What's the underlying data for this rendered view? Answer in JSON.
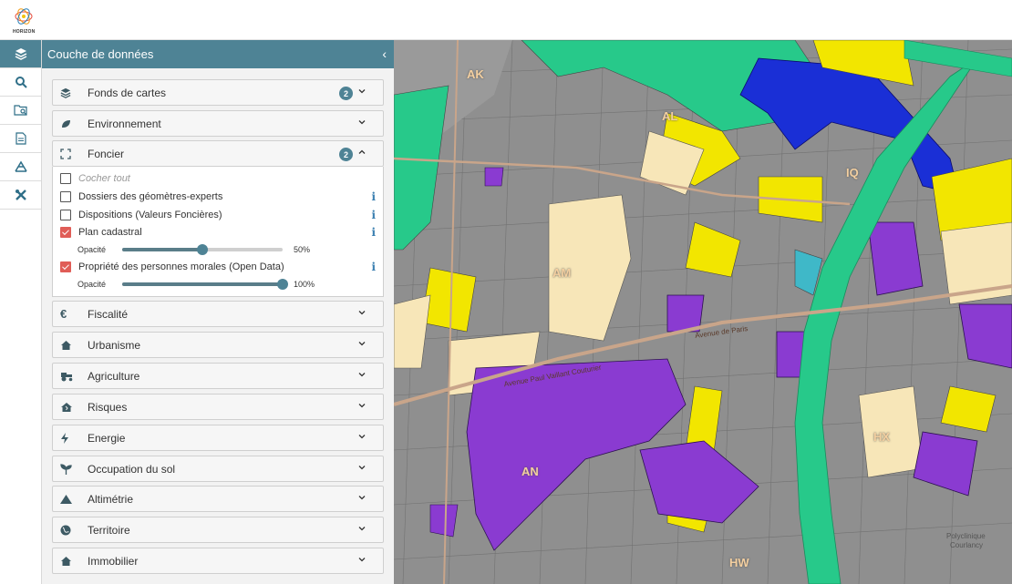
{
  "app": {
    "logo_text": "HORIZON"
  },
  "rail": {
    "items": [
      {
        "icon": "layers-icon",
        "active": true
      },
      {
        "icon": "search-icon",
        "active": false
      },
      {
        "icon": "folder-search-icon",
        "active": false
      },
      {
        "icon": "document-icon",
        "active": false
      },
      {
        "icon": "measure-icon",
        "active": false
      },
      {
        "icon": "tools-icon",
        "active": false
      }
    ]
  },
  "panel": {
    "title": "Couche de données",
    "collapse_glyph": "‹",
    "sections": [
      {
        "key": "fonds",
        "label": "Fonds de cartes",
        "icon": "layers-icon",
        "badge": "2",
        "expanded": false
      },
      {
        "key": "environnement",
        "label": "Environnement",
        "icon": "leaf-icon",
        "badge": "",
        "expanded": false
      },
      {
        "key": "foncier",
        "label": "Foncier",
        "icon": "expand-corners-icon",
        "badge": "2",
        "expanded": true
      },
      {
        "key": "fiscalite",
        "label": "Fiscalité",
        "icon": "euro-icon",
        "badge": "",
        "expanded": false
      },
      {
        "key": "urbanisme",
        "label": "Urbanisme",
        "icon": "home-icon",
        "badge": "",
        "expanded": false
      },
      {
        "key": "agriculture",
        "label": "Agriculture",
        "icon": "tractor-icon",
        "badge": "",
        "expanded": false
      },
      {
        "key": "risques",
        "label": "Risques",
        "icon": "house-damage-icon",
        "badge": "",
        "expanded": false
      },
      {
        "key": "energie",
        "label": "Energie",
        "icon": "bolt-icon",
        "badge": "",
        "expanded": false
      },
      {
        "key": "occupation",
        "label": "Occupation du sol",
        "icon": "seedling-icon",
        "badge": "",
        "expanded": false
      },
      {
        "key": "altimetrie",
        "label": "Altimétrie",
        "icon": "mountain-icon",
        "badge": "",
        "expanded": false
      },
      {
        "key": "territoire",
        "label": "Territoire",
        "icon": "globe-icon",
        "badge": "",
        "expanded": false
      },
      {
        "key": "immobilier",
        "label": "Immobilier",
        "icon": "home-icon",
        "badge": "",
        "expanded": false
      }
    ],
    "foncier": {
      "check_all": "Cocher tout",
      "layers": [
        {
          "label": "Dossiers des géomètres-experts",
          "checked": false,
          "info": "i"
        },
        {
          "label": "Dispositions (Valeurs Foncières)",
          "checked": false,
          "info": "i"
        },
        {
          "label": "Plan cadastral",
          "checked": true,
          "info": "i",
          "opacity_label": "Opacité",
          "opacity": 50,
          "opacity_text": "50%"
        },
        {
          "label": "Propriété des personnes morales (Open Data)",
          "checked": true,
          "info": "i",
          "opacity_label": "Opacité",
          "opacity": 100,
          "opacity_text": "100%"
        }
      ]
    }
  },
  "map": {
    "parcel_labels": [
      "AK",
      "AL",
      "AM",
      "AN",
      "HW",
      "HX",
      "IQ"
    ],
    "street_labels": [
      "Avenue Paul Vaillant Couturier",
      "Avenue de Paris"
    ],
    "poi_labels": [
      "Polyclinique",
      "Courlancy"
    ],
    "colors": {
      "purple": "#8a3bd1",
      "yellow": "#f2e600",
      "green": "#27c98a",
      "blue": "#1a2fd6",
      "cream": "#f7e6b8",
      "gray": "#9a9a9a"
    }
  }
}
